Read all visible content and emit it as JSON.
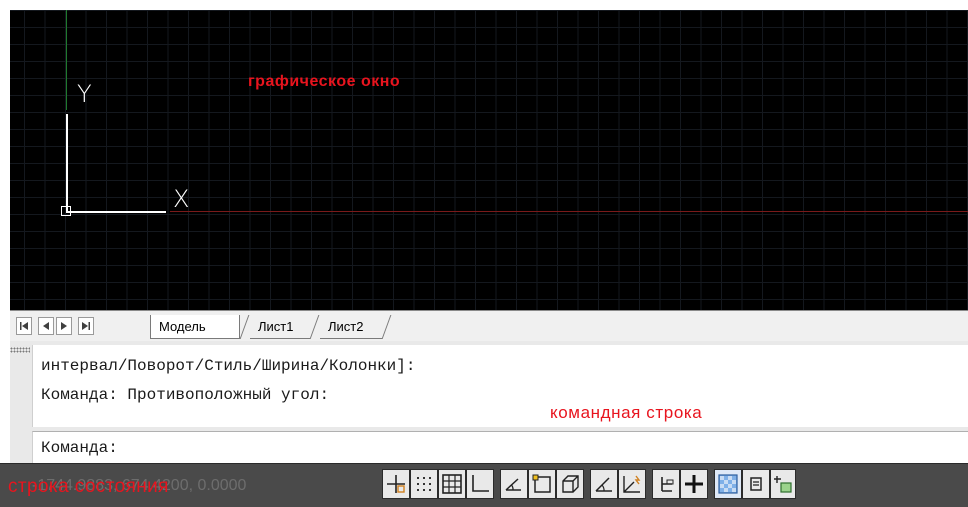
{
  "canvas": {
    "overlay_label": "графическое окно",
    "axis_y_label": "Y",
    "axis_x_label": "X"
  },
  "tabs": {
    "nav": [
      "first",
      "previous",
      "next",
      "last"
    ],
    "items": [
      {
        "label": "Модель",
        "active": true
      },
      {
        "label": "Лист1",
        "active": false
      },
      {
        "label": "Лист2",
        "active": false
      }
    ]
  },
  "command_line": {
    "history": [
      "интервал/Поворот/Стиль/Ширина/Колонки]:",
      "Команда: Противоположный угол:"
    ],
    "overlay_label": "командная строка",
    "prompt": "Команда:",
    "input_value": ""
  },
  "status_bar": {
    "overlay_label": "строка состояния",
    "coordinates": "-1744.9883, 674.4200, 0.0000",
    "toggles": [
      {
        "icon": "infer-constraints-icon",
        "on": false
      },
      {
        "icon": "snap-mode-icon",
        "on": false
      },
      {
        "icon": "grid-display-icon",
        "on": false
      },
      {
        "icon": "ortho-mode-icon",
        "on": false
      },
      {
        "icon": "polar-tracking-icon",
        "on": false
      },
      {
        "icon": "object-snap-icon",
        "on": false
      },
      {
        "icon": "3d-object-snap-icon",
        "on": false
      },
      {
        "icon": "object-snap-tracking-icon",
        "on": false
      },
      {
        "icon": "dynamic-ucs-icon",
        "on": false
      },
      {
        "icon": "dynamic-input-icon",
        "on": false
      },
      {
        "icon": "lineweight-icon",
        "on": false
      },
      {
        "icon": "transparency-icon",
        "on": true
      },
      {
        "icon": "quick-properties-icon",
        "on": false
      },
      {
        "icon": "selection-cycling-icon",
        "on": false
      }
    ]
  },
  "colors": {
    "annotation_red": "#e8141e",
    "canvas_bg": "#000000",
    "status_bg": "#4a4a4a"
  }
}
